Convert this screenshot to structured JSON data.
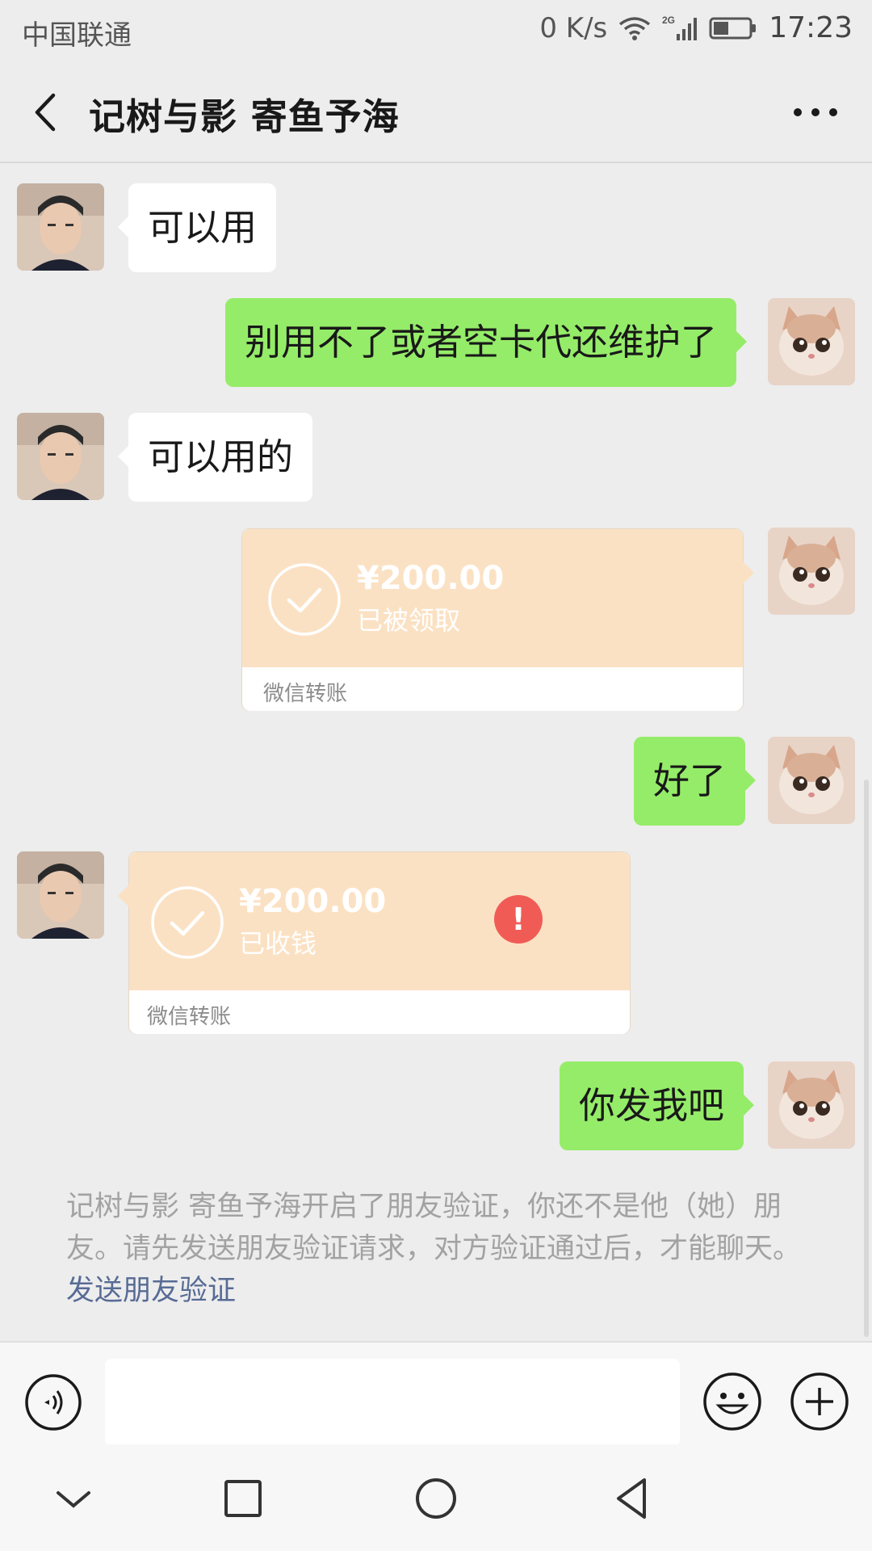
{
  "status_bar": {
    "carrier": "中国联通",
    "speed": "0 K/s",
    "network": "2G",
    "time": "17:23"
  },
  "header": {
    "title": "记树与影 寄鱼予海"
  },
  "messages": [
    {
      "side": "left",
      "type": "text",
      "text": "可以用"
    },
    {
      "side": "right",
      "type": "text",
      "text": "别用不了或者空卡代还维护了"
    },
    {
      "side": "left",
      "type": "text",
      "text": "可以用的"
    },
    {
      "side": "right",
      "type": "transfer",
      "amount": "¥200.00",
      "status": "已被领取",
      "label": "微信转账"
    },
    {
      "side": "right",
      "type": "text",
      "text": "好了"
    },
    {
      "side": "left",
      "type": "transfer",
      "amount": "¥200.00",
      "status": "已收钱",
      "label": "微信转账"
    },
    {
      "side": "right",
      "type": "text",
      "text": "你发我吧",
      "failed": true
    }
  ],
  "system_note": {
    "text": "记树与影 寄鱼予海开启了朋友验证，你还不是他（她）朋友。请先发送朋友验证请求，对方验证通过后，才能聊天。",
    "link": "发送朋友验证"
  },
  "input": {
    "value": "",
    "placeholder": ""
  },
  "icons": {
    "back": "back-arrow-icon",
    "more": "more-dots-icon",
    "voice": "voice-icon",
    "emoji": "emoji-icon",
    "plus": "plus-icon",
    "check": "check-circle-icon",
    "error": "error-icon"
  },
  "colors": {
    "green_bubble": "#95ec69",
    "white_bubble": "#ffffff",
    "transfer": "#fbe1c3",
    "link": "#576b95",
    "error": "#f15b56"
  }
}
